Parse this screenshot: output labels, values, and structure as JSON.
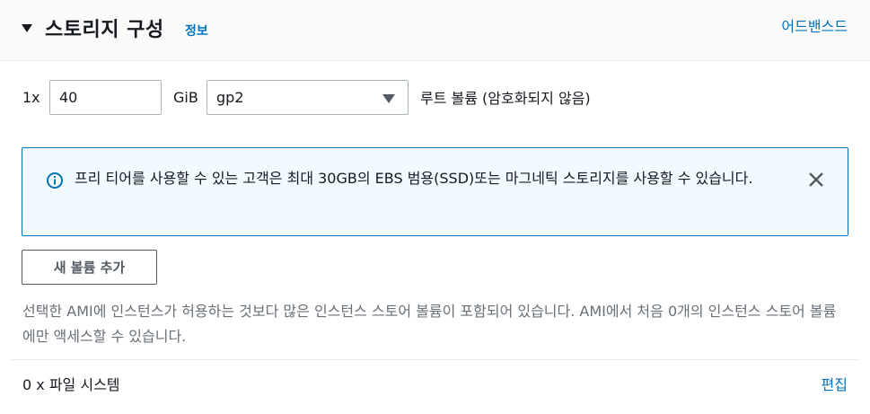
{
  "section": {
    "title": "스토리지 구성",
    "info_link": "정보",
    "advanced_link": "어드밴스드",
    "icons": {
      "collapse": "caret-down-icon"
    }
  },
  "volume": {
    "multiplier": "1x",
    "size_value": "40",
    "size_unit": "GiB",
    "type_selected": "gp2",
    "root_label": "루트 볼륨  (암호화되지 않음)"
  },
  "alert": {
    "message": "프리 티어를 사용할 수 있는 고객은 최대 30GB의 EBS 범용(SSD)또는 마그네틱 스토리지를 사용할 수 있습니다.",
    "icons": {
      "info": "info-circle-icon",
      "close": "close-icon"
    }
  },
  "add_volume_button": "새 볼륨 추가",
  "instance_store_note": "선택한 AMI에 인스턴스가 허용하는 것보다 많은 인스턴스 스토어 볼륨이 포함되어 있습니다. AMI에서 처음 0개의 인스턴스 스토어 볼륨에만 액세스할 수 있습니다.",
  "file_systems": {
    "label": "0 x 파일 시스템",
    "edit_link": "편집"
  },
  "colors": {
    "link": "#0073bb",
    "alert_border": "#0073bb",
    "alert_bg": "#f1faff",
    "header_bg": "#fafafa",
    "muted_text": "#687078"
  }
}
